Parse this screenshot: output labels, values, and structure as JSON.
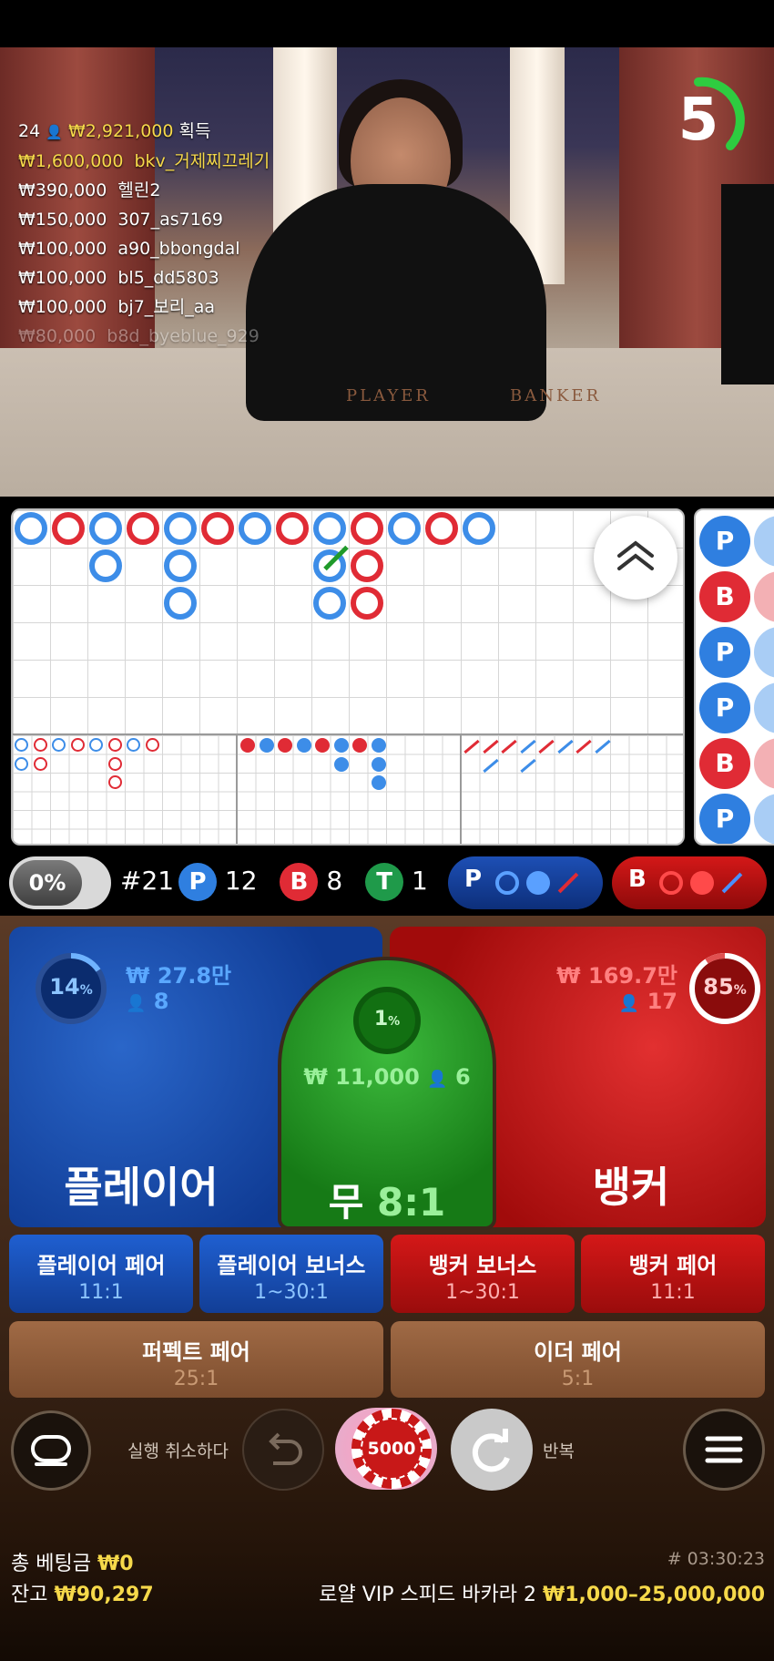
{
  "video": {
    "players_count": "24",
    "total_win": "₩2,921,000",
    "win_label": "획득",
    "timer": "5",
    "winners": [
      {
        "amount": "₩1,600,000",
        "name": "bkv_거제찌끄레기",
        "highlight": true
      },
      {
        "amount": "₩390,000",
        "name": "헬린2",
        "highlight": false
      },
      {
        "amount": "₩150,000",
        "name": "307_as7169",
        "highlight": false
      },
      {
        "amount": "₩100,000",
        "name": "a90_bbongdal",
        "highlight": false
      },
      {
        "amount": "₩100,000",
        "name": "bl5_dd5803",
        "highlight": false
      },
      {
        "amount": "₩100,000",
        "name": "bj7_보리_aa",
        "highlight": false
      },
      {
        "amount": "₩80,000",
        "name": "b8d_byeblue_929",
        "highlight": false
      }
    ],
    "table_markings": {
      "player": "PLAYER",
      "banker": "BANKER"
    }
  },
  "roadmap": {
    "side_results": [
      "P",
      "B",
      "P",
      "P",
      "B",
      "P"
    ]
  },
  "stats": {
    "progress": "0%",
    "round": "#21",
    "player_letter": "P",
    "player_count": "12",
    "banker_letter": "B",
    "banker_count": "8",
    "tie_letter": "T",
    "tie_count": "1",
    "player_predict": "P",
    "banker_predict": "B"
  },
  "bets": {
    "player": {
      "percent": "14",
      "amount": "₩ 27.8만",
      "users": "8",
      "label": "플레이어"
    },
    "banker": {
      "percent": "85",
      "amount": "₩ 169.7만",
      "users": "17",
      "label": "뱅커"
    },
    "tie": {
      "percent": "1",
      "amount": "₩ 11,000",
      "users": "6",
      "label": "무",
      "odds": "8:1"
    },
    "percent_sign": "%",
    "side": [
      {
        "label": "플레이어 페어",
        "odds": "11:1"
      },
      {
        "label": "플레이어 보너스",
        "odds": "1~30:1"
      },
      {
        "label": "뱅커 보너스",
        "odds": "1~30:1"
      },
      {
        "label": "뱅커 페어",
        "odds": "11:1"
      }
    ],
    "perfect_pair": {
      "label": "퍼펙트 페어",
      "odds": "25:1"
    },
    "either_pair": {
      "label": "이더 페어",
      "odds": "5:1"
    }
  },
  "controls": {
    "undo_label": "실행 취소하다",
    "chip_value": "5000",
    "repeat_label": "반복"
  },
  "footer": {
    "total_bet_label": "총 베팅금",
    "total_bet": "₩0",
    "balance_label": "잔고",
    "balance": "₩90,297",
    "round_id": "# 03:30:23",
    "table_name": "로얄 VIP 스피드 바카라 2",
    "limits": "₩1,000–25,000,000"
  },
  "colors": {
    "player": "#1f5fd0",
    "banker": "#d41818",
    "tie": "#1f9a2a",
    "gold": "#f6d94a"
  }
}
